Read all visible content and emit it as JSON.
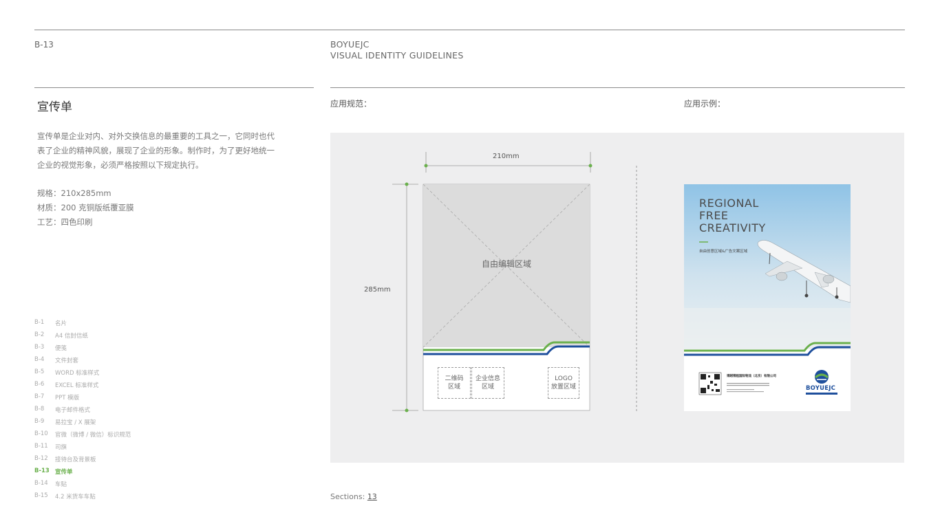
{
  "header": {
    "code": "B-13",
    "brand_line1": "BOYUEJC",
    "brand_line2": "VISUAL IDENTITY GUIDELINES"
  },
  "left": {
    "title": "宣传单",
    "description": "宣传单是企业对内、对外交换信息的最重要的工具之一，它同时也代表了企业的精神风貌，展现了企业的形象。制作时，为了更好地统一企业的视觉形象，必须严格按照以下规定执行。",
    "specs": [
      "规格：210x285mm",
      "材质：200 克铜版纸覆亚膜",
      "工艺：四色印刷"
    ]
  },
  "toc": [
    {
      "code": "B-1",
      "label": "名片"
    },
    {
      "code": "B-2",
      "label": "A4 信封信纸"
    },
    {
      "code": "B-3",
      "label": "便笺"
    },
    {
      "code": "B-4",
      "label": "文件封套"
    },
    {
      "code": "B-5",
      "label": "WORD 标准样式"
    },
    {
      "code": "B-6",
      "label": "EXCEL 标准样式"
    },
    {
      "code": "B-7",
      "label": "PPT 模版"
    },
    {
      "code": "B-8",
      "label": "电子邮件格式"
    },
    {
      "code": "B-9",
      "label": "易拉宝 / X 展架"
    },
    {
      "code": "B-10",
      "label": "官微（微博 / 微信）标识规范"
    },
    {
      "code": "B-11",
      "label": "司旗"
    },
    {
      "code": "B-12",
      "label": "接待台及背景板"
    },
    {
      "code": "B-13",
      "label": "宣传单",
      "active": true
    },
    {
      "code": "B-14",
      "label": "车贴"
    },
    {
      "code": "B-15",
      "label": "4.2 米货车车贴"
    }
  ],
  "section_labels": {
    "spec": "应用规范：",
    "example": "应用示例："
  },
  "diagram": {
    "width_label": "210mm",
    "height_label": "285mm",
    "free_area": "自由编辑区域",
    "qr_area": "二维码\n区域",
    "info_area": "企业信息\n区域",
    "logo_area": "LOGO\n放置区域"
  },
  "example": {
    "headline": [
      "REGIONAL",
      "FREE",
      "CREATIVITY"
    ],
    "subline": "自由创意区域&广告文案区域",
    "company": "博越锦程国际物流（北京）有限公司",
    "logo_text": "BOYUEJC"
  },
  "footer": {
    "sections_label": "Sections:",
    "sections_value": "13"
  },
  "colors": {
    "green": "#6ab04c",
    "blue": "#1e4f9c"
  }
}
